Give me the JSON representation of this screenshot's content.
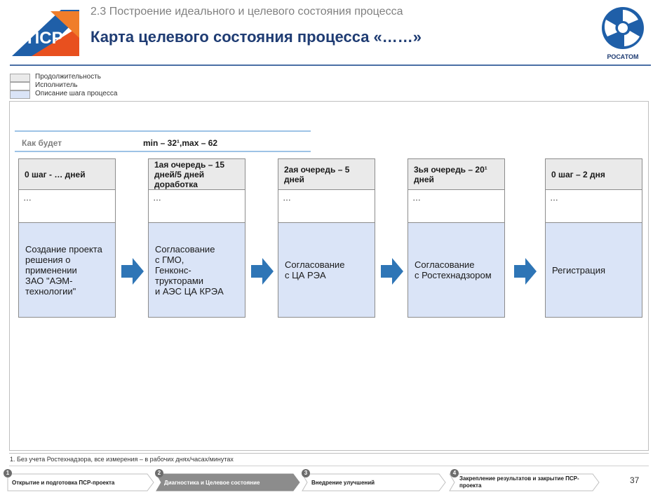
{
  "header": {
    "section_title": "2.3 Построение идеального и целевого состояния процесса",
    "page_title": "Карта целевого состояния процесса «……»",
    "logo_text": "ПСР",
    "rosatom_text": "РОСАТОМ"
  },
  "legend": {
    "items": [
      {
        "label": "Продолжительность",
        "color": "#eaeaea"
      },
      {
        "label": "Исполнитель",
        "color": "#ffffff"
      },
      {
        "label": "Описание шага процесса",
        "color": "#dae4f7"
      }
    ]
  },
  "timeline": {
    "label": "Как будет",
    "value": "min – 32¹,max – 62"
  },
  "steps": [
    {
      "duration": "0 шаг - … дней",
      "executor": "…",
      "description": "Создание проекта\nрешения о\nприменении\nЗАО \"АЭМ-\nтехнологии\""
    },
    {
      "duration": "1ая очередь – 15 дней/5 дней доработка",
      "executor": "…",
      "description": "Согласование\nс ГМО,\nГенконс-\nтрукторами\nи АЭС ЦА КРЭА"
    },
    {
      "duration": "2ая очередь – 5 дней",
      "executor": "…",
      "description": "Согласование\nс ЦА РЭА"
    },
    {
      "duration": "3ья очередь – 20¹ дней",
      "executor": "…",
      "description": "Согласование\nс Ростехнадзором"
    },
    {
      "duration": "0 шаг – 2 дня",
      "executor": "…",
      "description": "Регистрация"
    }
  ],
  "footnote": "1. Без учета Ростехнадзора, все измерения – в рабочих днях/часах/минутах",
  "footer": {
    "nav": [
      {
        "num": "1",
        "label": "Открытие и подготовка ПСР-проекта",
        "active": false
      },
      {
        "num": "2",
        "label": "Диагностика и Целевое состояние",
        "active": true
      },
      {
        "num": "3",
        "label": "Внедрение улучшений",
        "active": false
      },
      {
        "num": "4",
        "label": "Закрепление результатов и закрытие ПСР-проекта",
        "active": false
      }
    ],
    "page_number": "37"
  },
  "colors": {
    "title_blue": "#1f3c73",
    "arrow_blue": "#2e75b6",
    "description_fill": "#dae4f7",
    "logo_orange": "#e8501f",
    "logo_blue": "#1f5fa8"
  }
}
